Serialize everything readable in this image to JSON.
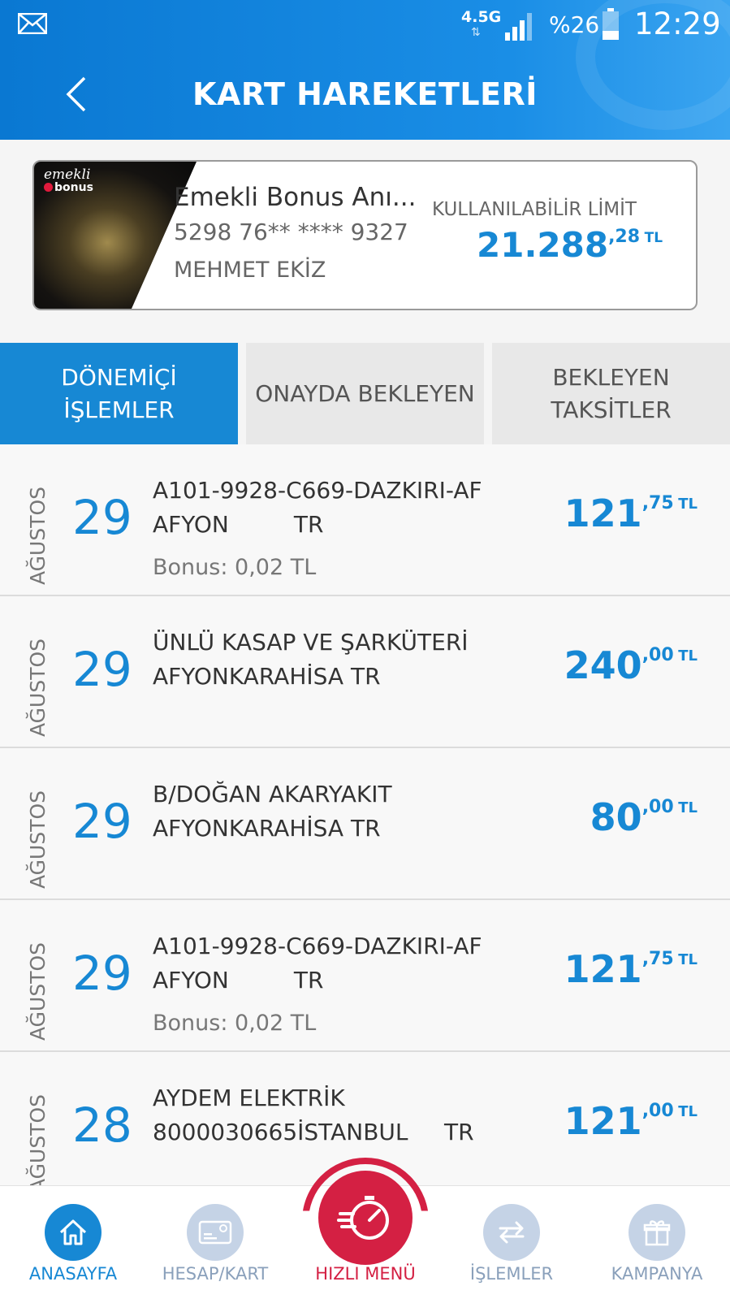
{
  "status_bar": {
    "network": "4.5G",
    "network_arrows": "⇅",
    "battery": "%26",
    "time": "12:29"
  },
  "header": {
    "title": "KART HAREKETLERİ"
  },
  "card": {
    "brand_line1": "emekli",
    "brand_line2": "bonus",
    "name": "Emekli Bonus Anı...",
    "number": "5298 76** **** 9327",
    "holder": "MEHMET EKİZ",
    "limit_label": "KULLANILABİLİR LİMİT",
    "limit_int": "21.288",
    "limit_dec": ",28",
    "limit_currency": "TL"
  },
  "tabs": [
    {
      "line1": "DÖNEMİÇİ",
      "line2": "İŞLEMLER"
    },
    {
      "line1": "ONAYDA BEKLEYEN",
      "line2": ""
    },
    {
      "line1": "BEKLEYEN",
      "line2": "TAKSİTLER"
    }
  ],
  "transactions": [
    {
      "month": "AĞUSTOS",
      "day": "29",
      "line1": "A101-9928-C669-DAZKIRI-AF",
      "line2": "AFYON         TR",
      "bonus": "Bonus: 0,02 TL",
      "amount_int": "121",
      "amount_dec": ",75",
      "currency": "TL"
    },
    {
      "month": "AĞUSTOS",
      "day": "29",
      "line1": "ÜNLÜ KASAP VE ŞARKÜTERİ",
      "line2": "AFYONKARAHİSA TR",
      "bonus": "",
      "amount_int": "240",
      "amount_dec": ",00",
      "currency": "TL"
    },
    {
      "month": "AĞUSTOS",
      "day": "29",
      "line1": "B/DOĞAN AKARYAKIT",
      "line2": "AFYONKARAHİSA TR",
      "bonus": "",
      "amount_int": "80",
      "amount_dec": ",00",
      "currency": "TL"
    },
    {
      "month": "AĞUSTOS",
      "day": "29",
      "line1": "A101-9928-C669-DAZKIRI-AF",
      "line2": "AFYON         TR",
      "bonus": "Bonus: 0,02 TL",
      "amount_int": "121",
      "amount_dec": ",75",
      "currency": "TL"
    },
    {
      "month": "AĞUSTOS",
      "day": "28",
      "line1": "AYDEM ELEKTRİK",
      "line2": "8000030665İSTANBUL     TR",
      "bonus": "",
      "amount_int": "121",
      "amount_dec": ",00",
      "currency": "TL"
    }
  ],
  "bottom_nav": [
    {
      "label": "ANASAYFA",
      "icon": "home-icon"
    },
    {
      "label": "HESAP/KART",
      "icon": "card-icon"
    },
    {
      "label": "HIZLI MENÜ",
      "icon": "stopwatch-icon"
    },
    {
      "label": "İŞLEMLER",
      "icon": "transfer-icon"
    },
    {
      "label": "KAMPANYA",
      "icon": "gift-icon"
    }
  ],
  "colors": {
    "primary": "#1788d4",
    "accent": "#d42043"
  }
}
